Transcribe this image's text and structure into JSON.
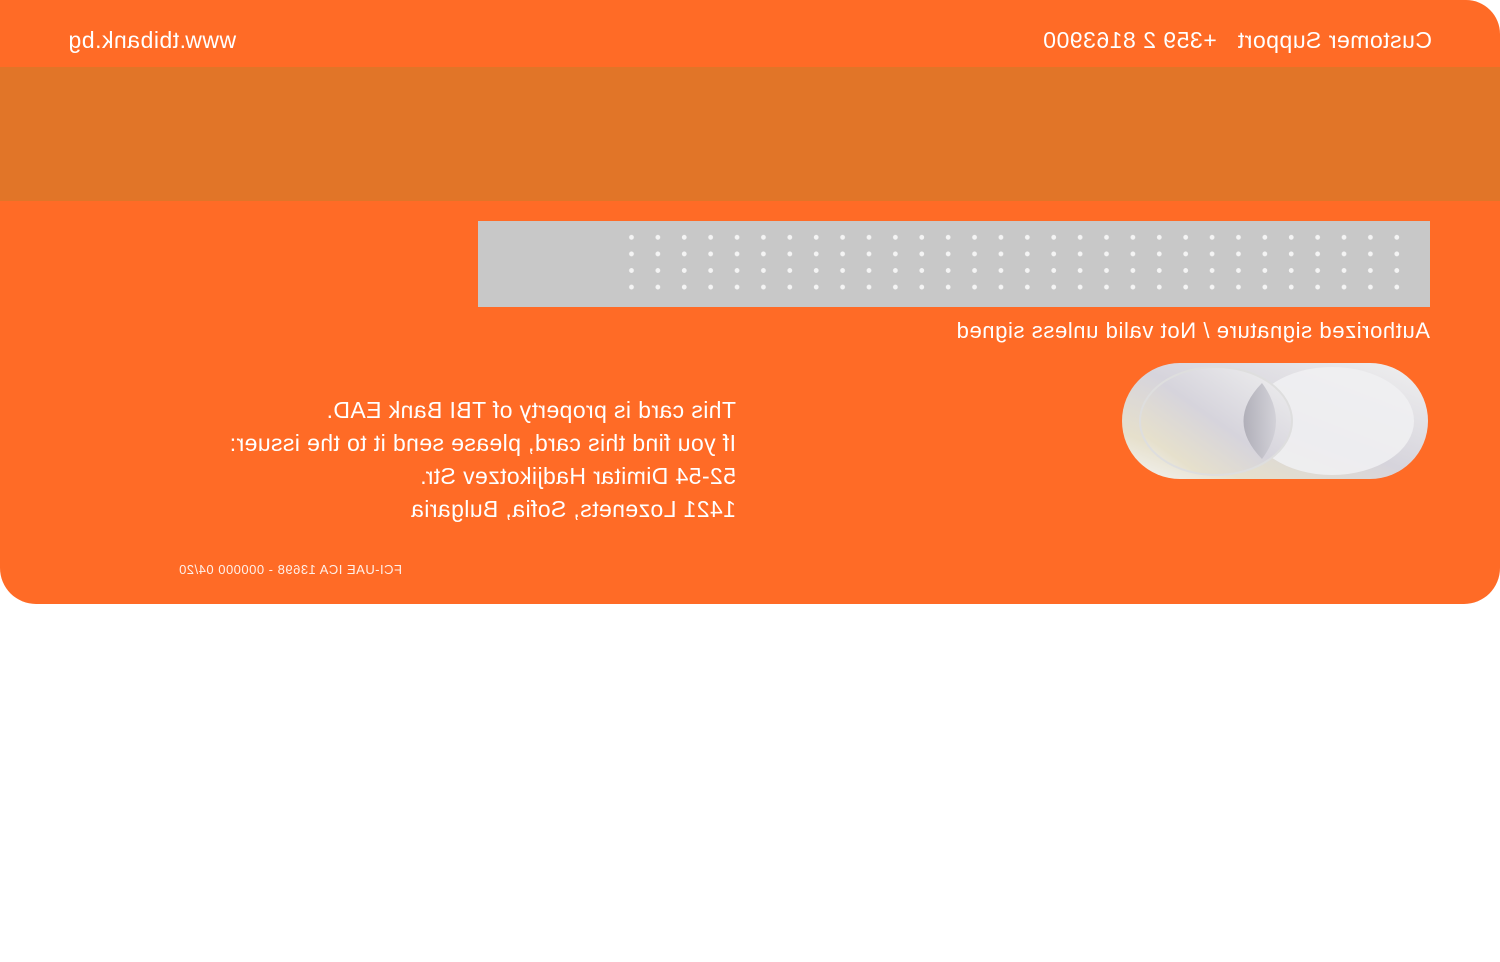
{
  "card": {
    "website": "www.tbibank.bg",
    "support_label": "Customer Support",
    "support_phone": "+359 2 8163900",
    "signature_caption": "Authorized signature / Not valid unless signed",
    "address_lines": [
      "This card is property of TBI Bank EAD.",
      "If you find this card, please send it to the issuer:",
      "52-54 Dimitar Hadjikotzev Str.",
      "1421 Lozenets, Sofia, Bulgaria"
    ],
    "legal_code": "FCI-UAE ICA 13698 - 000000 04/20",
    "logo_icon": "hologram-logo-icon",
    "colors": {
      "card_orange": "#ff6b26",
      "magnetic_stripe": "#e17528",
      "signature_panel": "#c8c8c8",
      "text": "#ffffff"
    }
  }
}
